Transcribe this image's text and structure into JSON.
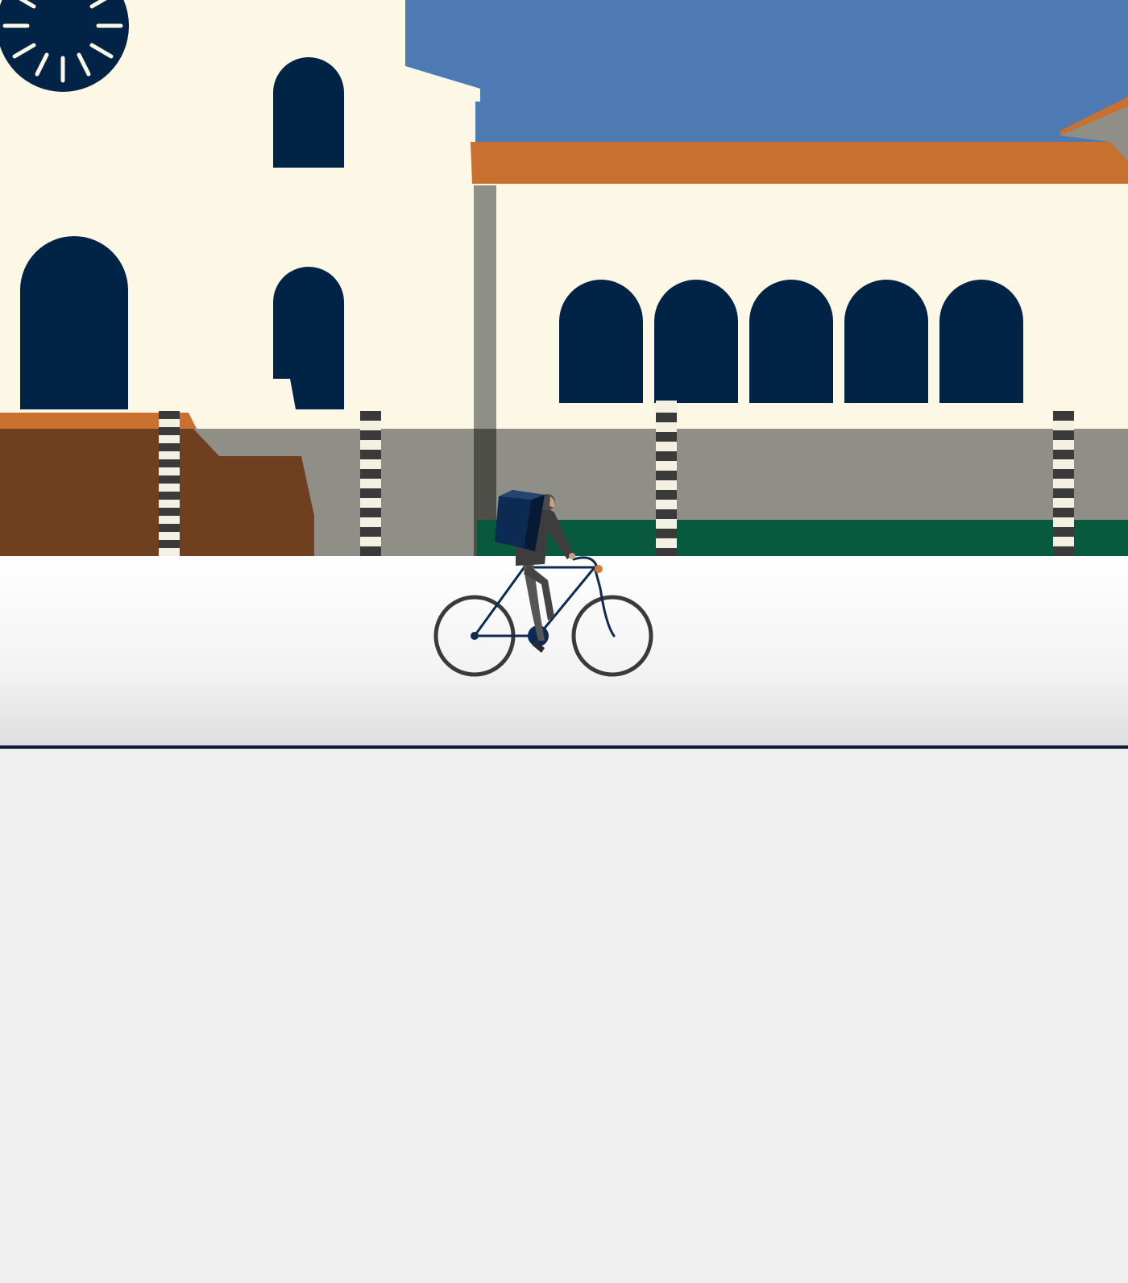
{
  "scene": {
    "description_icons": [
      "clock-rosette-icon",
      "cyclist-icon",
      "bicycle-icon",
      "delivery-backpack-icon"
    ],
    "colors": {
      "sky": "#4e7ab3",
      "facade": "#fdf8e6",
      "window": "#012346",
      "roof": "#c87030",
      "wall": "#8f8e87",
      "shadow_column": "#4f4f4a",
      "brown_wall": "#6f3f1f",
      "brown_trim": "#c9702e",
      "hedge": "#075a3e",
      "ground_top": "#ffffff",
      "ground_bottom": "#dcdcdc",
      "divider": "#0a1a33",
      "lower_panel": "#efefef",
      "pole_dark": "#3a3a3a",
      "pole_light": "#f4f0e2",
      "rider_dark": "#3d3d3d",
      "backpack": "#0d2a52",
      "accent_orange": "#d67a30"
    }
  }
}
